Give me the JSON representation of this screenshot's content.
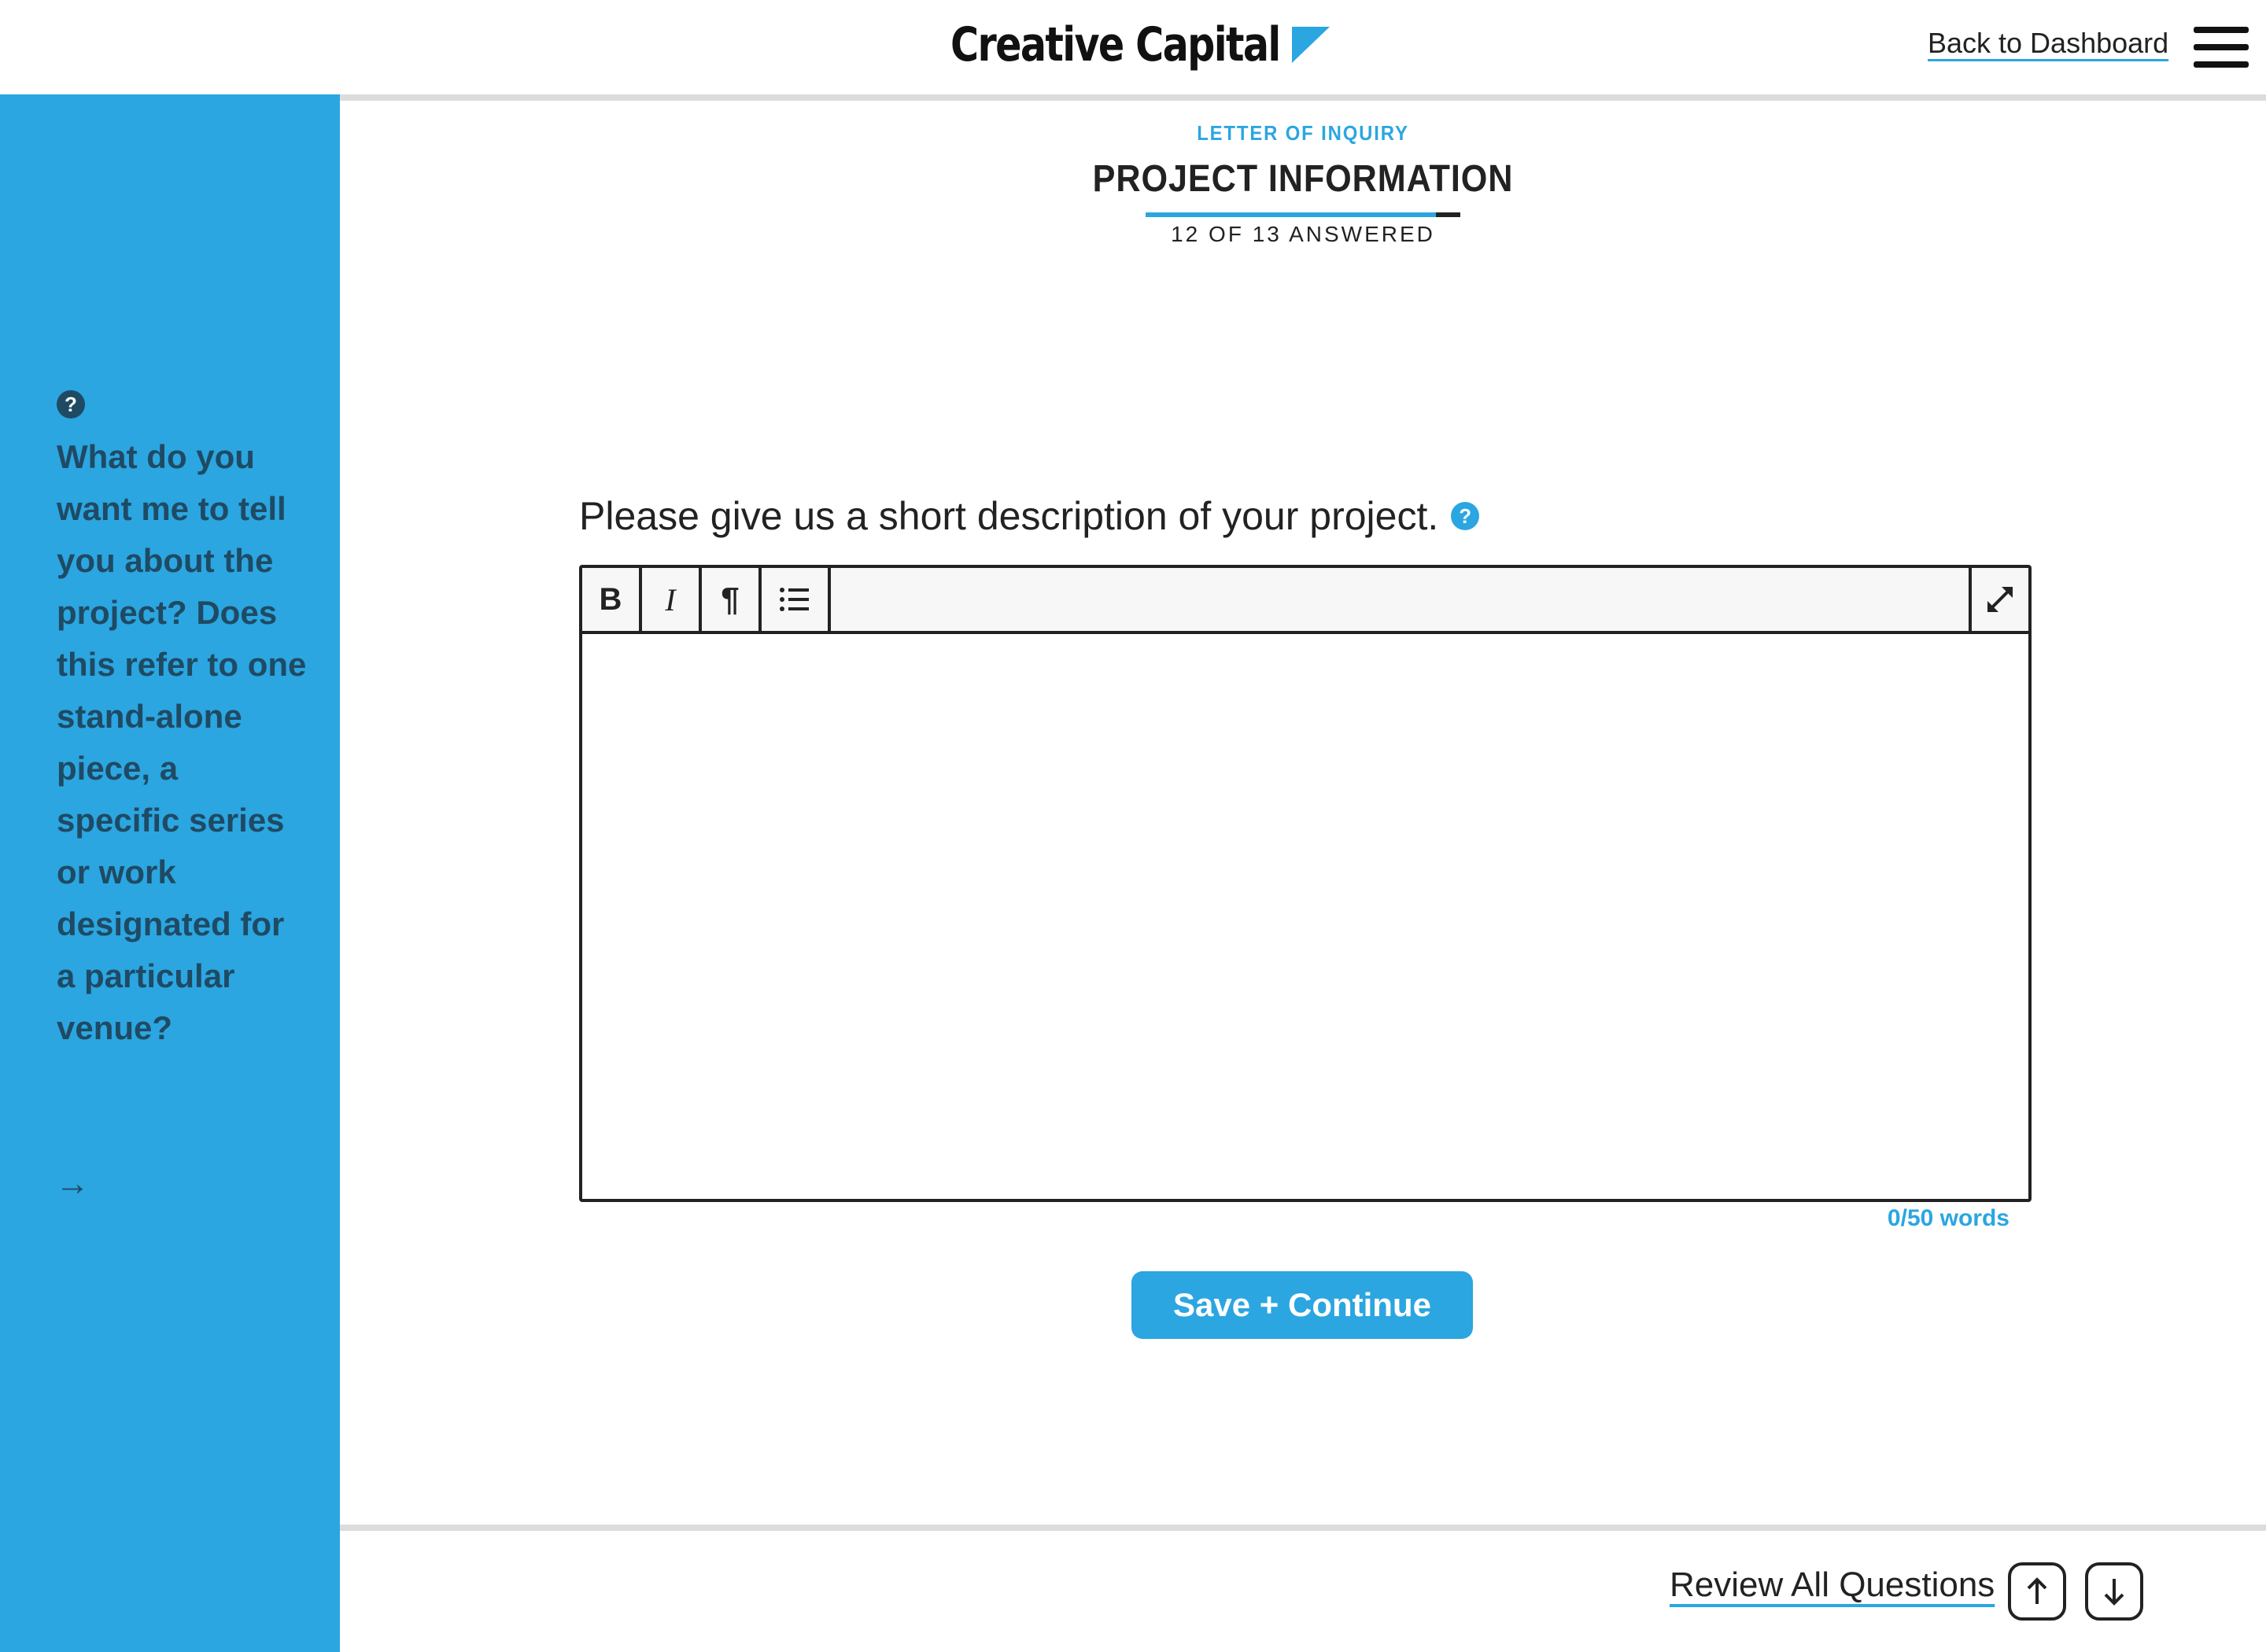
{
  "header": {
    "logo_text": "Creative Capital",
    "back_link": "Back to Dashboard",
    "menu_icon": "hamburger-menu-icon"
  },
  "sidebar": {
    "help_icon_glyph": "?",
    "help_text": "What do you want me to tell you about the project? Does this refer to one stand-alone piece, a specific series or work designated for a particular venue?",
    "arrow_glyph": "→"
  },
  "section": {
    "eyebrow": "LETTER OF INQUIRY",
    "title": "PROJECT INFORMATION",
    "answered_text": "12 OF 13 ANSWERED",
    "progress_fraction": 0.923
  },
  "question": {
    "label": "Please give us a short description of your project.",
    "help_glyph": "?"
  },
  "editor": {
    "toolbar": {
      "bold_label": "B",
      "italic_label": "I",
      "paragraph_label": "¶",
      "list_icon": "bulleted-list-icon",
      "expand_icon": "expand-icon"
    },
    "value": "",
    "word_count": "0/50 words"
  },
  "actions": {
    "save_label": "Save + Continue",
    "review_label": "Review All Questions",
    "prev_icon": "arrow-up-icon",
    "next_icon": "arrow-down-icon"
  },
  "colors": {
    "accent": "#2ba6e1",
    "sidebar_text": "#1f4a63",
    "text": "#222222"
  }
}
